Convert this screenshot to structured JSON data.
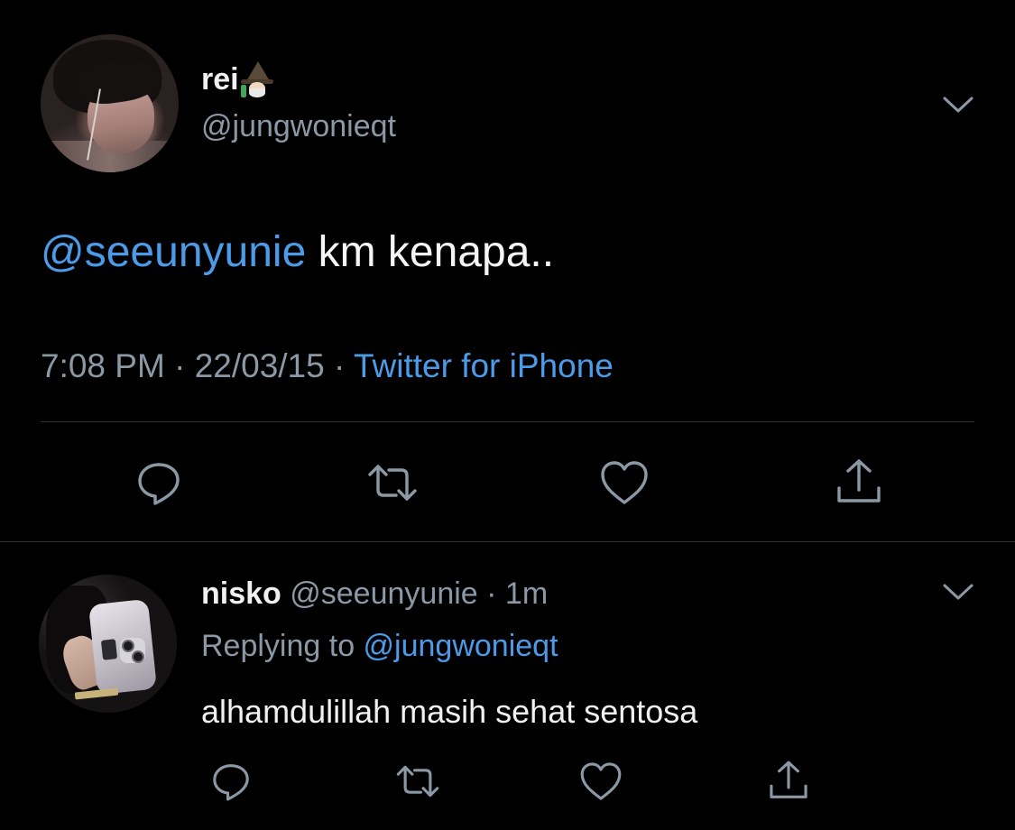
{
  "main_tweet": {
    "author_name": "rei",
    "author_emoji": "wizard-emoji",
    "author_handle": "@jungwonieqt",
    "text_mention": "@seeunyunie",
    "text_body": " km kenapa..",
    "time": "7:08 PM",
    "separator": " · ",
    "date": "22/03/15",
    "source": "Twitter for iPhone",
    "actions": [
      "reply-icon",
      "retweet-icon",
      "like-icon",
      "share-icon"
    ]
  },
  "reply_tweet": {
    "author_name": "nisko",
    "author_handle": " @seeunyunie",
    "separator": " · ",
    "age": "1m",
    "replying_prefix": "Replying to ",
    "replying_to": "@jungwonieqt",
    "text": "alhamdulillah masih sehat sentosa",
    "actions": [
      "reply-icon",
      "retweet-icon",
      "like-icon",
      "share-icon"
    ]
  },
  "colors": {
    "background": "#000000",
    "text_primary": "#f1f1f1",
    "text_secondary": "#8b98a5",
    "accent_link": "#4c9be8",
    "divider": "#2f3336"
  }
}
